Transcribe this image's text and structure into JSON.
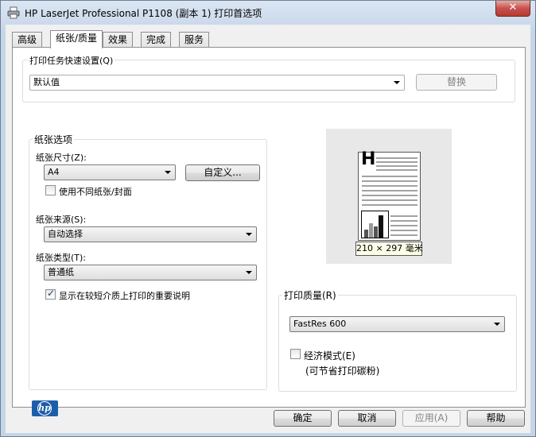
{
  "window": {
    "title": "HP LaserJet Professional P1108 (副本 1) 打印首选项",
    "close_glyph": "✕"
  },
  "tabs": [
    {
      "label": "高级"
    },
    {
      "label": "纸张/质量"
    },
    {
      "label": "效果"
    },
    {
      "label": "完成"
    },
    {
      "label": "服务"
    }
  ],
  "quick_set": {
    "group_label": "打印任务快速设置(Q)",
    "value": "默认值",
    "replace_button": "替换"
  },
  "paper_options": {
    "group_label": "纸张选项",
    "size_label": "纸张尺寸(Z):",
    "size_value": "A4",
    "custom_button": "自定义...",
    "different_paper_label": "使用不同纸张/封面",
    "source_label": "纸张来源(S):",
    "source_value": "自动选择",
    "type_label": "纸张类型(T):",
    "type_value": "普通纸",
    "show_notes_label": "显示在较短介质上打印的重要说明"
  },
  "preview": {
    "header_letter": "H",
    "size_text": "210 × 297 毫米"
  },
  "quality": {
    "group_label": "打印质量(R)",
    "value": "FastRes 600",
    "economode_label": "经济模式(E)",
    "economode_note": "(可节省打印碳粉)"
  },
  "logo": {
    "text": "hp"
  },
  "footer": {
    "ok": "确定",
    "cancel": "取消",
    "apply": "应用(A)",
    "help": "帮助"
  }
}
